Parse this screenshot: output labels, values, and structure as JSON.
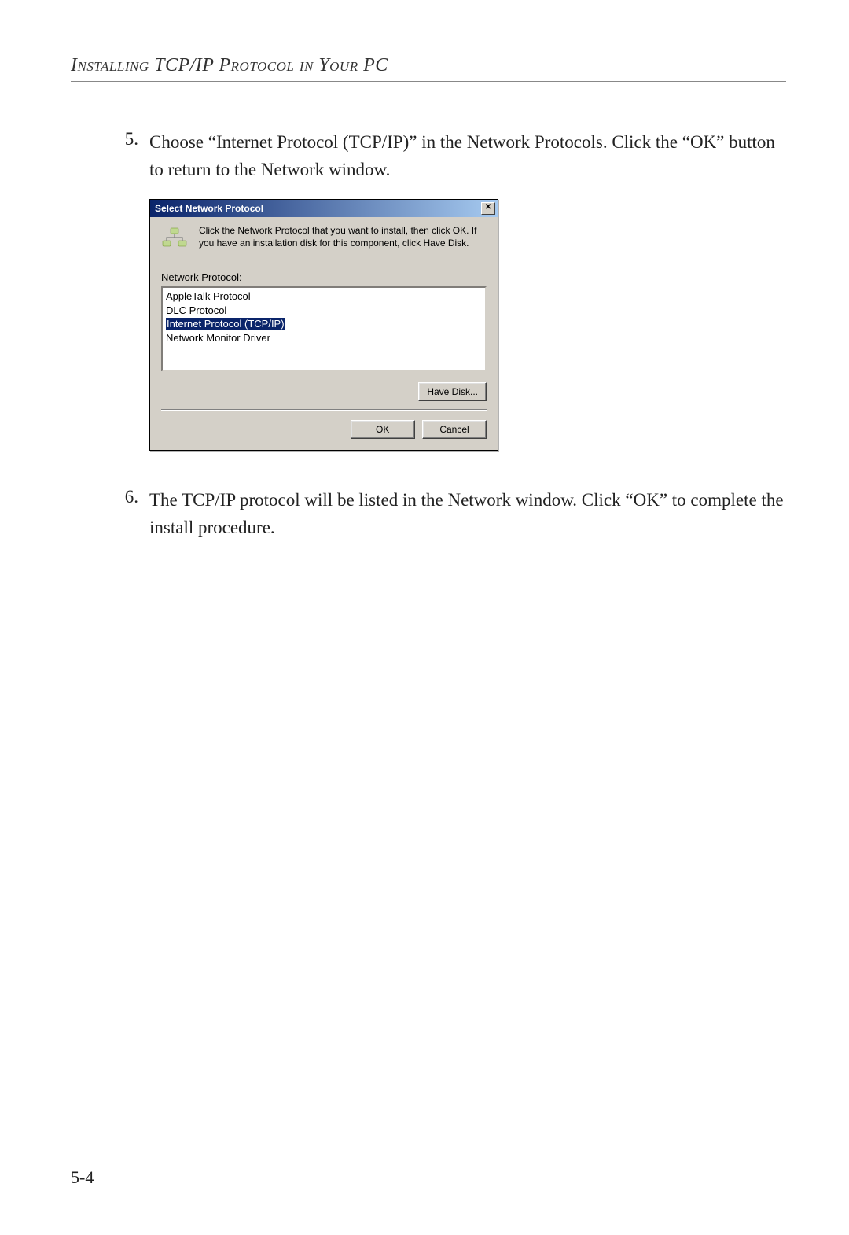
{
  "header": {
    "title": "Installing TCP/IP Protocol in Your PC"
  },
  "steps": [
    {
      "num": "5.",
      "text": "Choose “Internet Protocol (TCP/IP)” in the Network Protocols. Click the “OK” button to return to the Network window."
    },
    {
      "num": "6.",
      "text": "The TCP/IP protocol will be listed in the Network window. Click “OK” to complete the install procedure."
    }
  ],
  "dialog": {
    "title": "Select Network Protocol",
    "close_glyph": "✕",
    "instruction": "Click the Network Protocol that you want to install, then click OK. If you have an installation disk for this component, click Have Disk.",
    "list_label": "Network Protocol:",
    "items": [
      "AppleTalk Protocol",
      "DLC Protocol",
      "Internet Protocol (TCP/IP)",
      "Network Monitor Driver"
    ],
    "have_disk_label": "Have Disk...",
    "ok_label": "OK",
    "cancel_label": "Cancel"
  },
  "page_number": "5-4"
}
